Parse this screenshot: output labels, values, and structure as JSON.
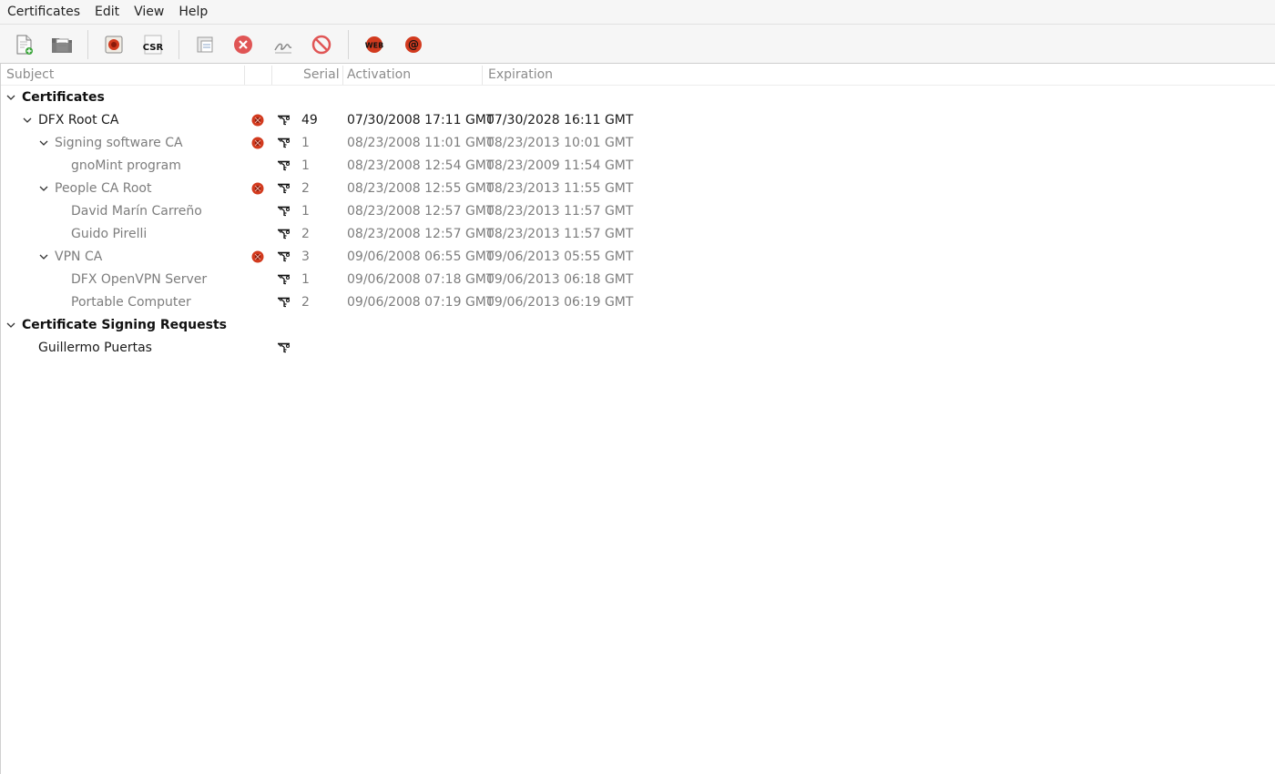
{
  "menubar": {
    "items": [
      "Certificates",
      "Edit",
      "View",
      "Help"
    ]
  },
  "toolbar": {
    "buttons": [
      {
        "name": "new-document-icon"
      },
      {
        "name": "open-folder-icon"
      },
      {
        "name": "new-ca-icon"
      },
      {
        "name": "csr-icon",
        "label": "CSR"
      },
      {
        "name": "properties-icon"
      },
      {
        "name": "delete-icon"
      },
      {
        "name": "sign-icon"
      },
      {
        "name": "revoke-icon"
      },
      {
        "name": "web-icon",
        "label": "WEB"
      },
      {
        "name": "email-icon",
        "label": "@"
      }
    ]
  },
  "tree": {
    "columns": {
      "subject": "Subject",
      "serial": "Serial",
      "activation": "Activation",
      "expiration": "Expiration"
    },
    "rows": [
      {
        "subject": "Certificates",
        "level": 0,
        "expander": true,
        "style": "bold"
      },
      {
        "subject": "DFX Root CA",
        "level": 1,
        "expander": true,
        "style": "normal",
        "ca": true,
        "key": true,
        "serial": "49",
        "activation": "07/30/2008 17:11 GMT",
        "expiration": "07/30/2028 16:11 GMT"
      },
      {
        "subject": "Signing software CA",
        "level": 2,
        "expander": true,
        "style": "dim",
        "ca": true,
        "key": true,
        "serial": "1",
        "activation": "08/23/2008 11:01 GMT",
        "expiration": "08/23/2013 10:01 GMT"
      },
      {
        "subject": "gnoMint program",
        "level": 3,
        "expander": false,
        "style": "dim",
        "ca": false,
        "key": true,
        "serial": "1",
        "activation": "08/23/2008 12:54 GMT",
        "expiration": "08/23/2009 11:54 GMT"
      },
      {
        "subject": "People CA Root",
        "level": 2,
        "expander": true,
        "style": "dim",
        "ca": true,
        "key": true,
        "serial": "2",
        "activation": "08/23/2008 12:55 GMT",
        "expiration": "08/23/2013 11:55 GMT"
      },
      {
        "subject": "David Marín Carreño",
        "level": 3,
        "expander": false,
        "style": "dim",
        "ca": false,
        "key": true,
        "serial": "1",
        "activation": "08/23/2008 12:57 GMT",
        "expiration": "08/23/2013 11:57 GMT"
      },
      {
        "subject": "Guido Pirelli",
        "level": 3,
        "expander": false,
        "style": "dim",
        "ca": false,
        "key": true,
        "serial": "2",
        "activation": "08/23/2008 12:57 GMT",
        "expiration": "08/23/2013 11:57 GMT"
      },
      {
        "subject": "VPN CA",
        "level": 2,
        "expander": true,
        "style": "dim",
        "ca": true,
        "key": true,
        "serial": "3",
        "activation": "09/06/2008 06:55 GMT",
        "expiration": "09/06/2013 05:55 GMT"
      },
      {
        "subject": "DFX OpenVPN Server",
        "level": 3,
        "expander": false,
        "style": "dim",
        "ca": false,
        "key": true,
        "serial": "1",
        "activation": "09/06/2008 07:18 GMT",
        "expiration": "09/06/2013 06:18 GMT"
      },
      {
        "subject": "Portable Computer",
        "level": 3,
        "expander": false,
        "style": "dim",
        "ca": false,
        "key": true,
        "serial": "2",
        "activation": "09/06/2008 07:19 GMT",
        "expiration": "09/06/2013 06:19 GMT"
      },
      {
        "subject": "Certificate Signing Requests",
        "level": 0,
        "expander": true,
        "style": "bold"
      },
      {
        "subject": "Guillermo Puertas",
        "level": 1,
        "expander": false,
        "style": "normal",
        "ca": false,
        "key": true,
        "serial": "",
        "activation": "",
        "expiration": ""
      }
    ]
  },
  "colors": {
    "ca_icon": "#d23a1e",
    "delete_icon": "#e05555",
    "dim_text": "#7d7d7d",
    "header_text": "#8c8c8c"
  }
}
